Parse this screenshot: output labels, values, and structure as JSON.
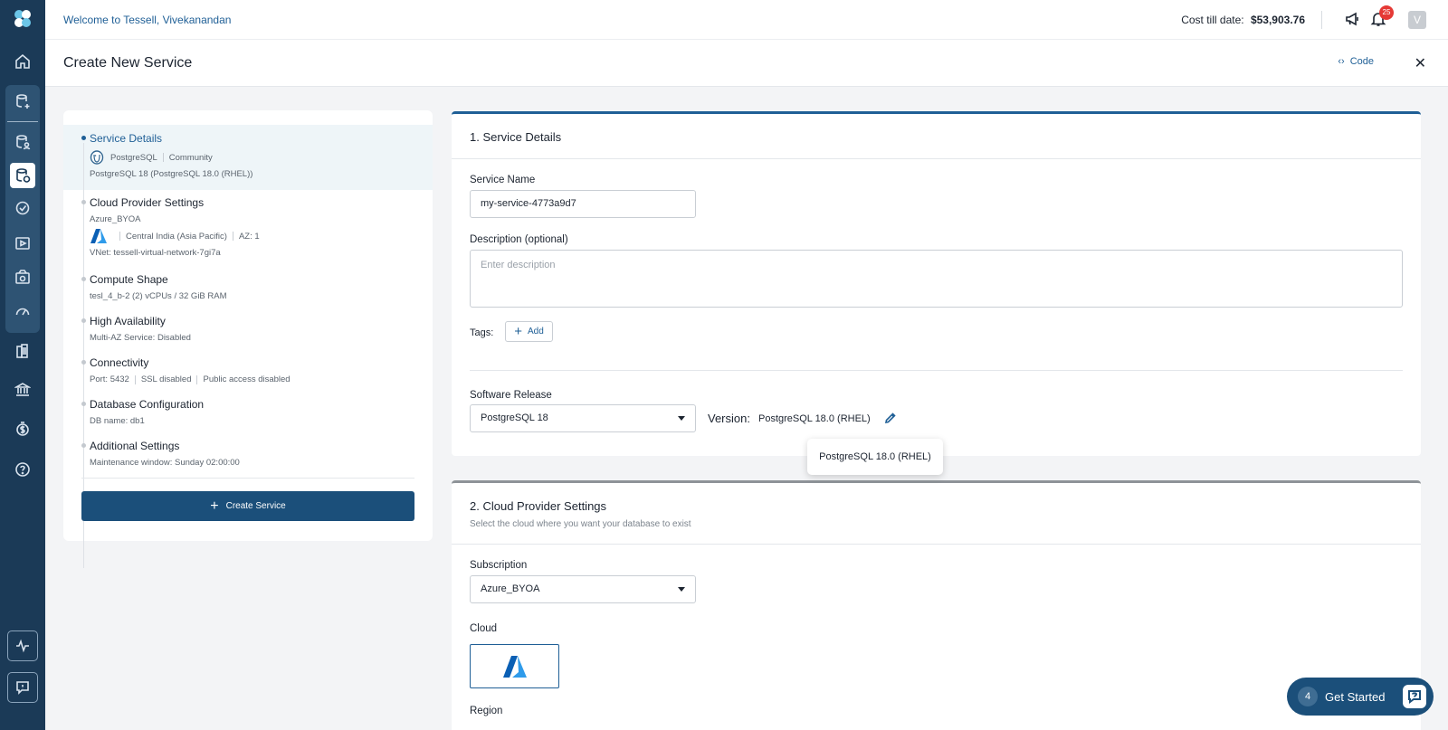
{
  "topbar": {
    "welcome": "Welcome to Tessell, Vivekanandan",
    "cost_label": "Cost till date:",
    "cost_value": "$53,903.76",
    "notification_count": "25",
    "avatar_initial": "V"
  },
  "header": {
    "title": "Create New Service",
    "code_label": "Code",
    "close_glyph": "✕"
  },
  "summary": {
    "items": [
      {
        "title": "Service Details",
        "line1_a": "PostgreSQL",
        "line1_b": "Community",
        "line2": "PostgreSQL 18 (PostgreSQL 18.0 (RHEL))"
      },
      {
        "title": "Cloud Provider Settings",
        "line1": "Azure_BYOA",
        "line2_a": "Central India (Asia Pacific)",
        "line2_b": "AZ: 1",
        "line3": "VNet: tessell-virtual-network-7gi7a"
      },
      {
        "title": "Compute Shape",
        "line1": "tesl_4_b-2 (2) vCPUs / 32 GiB RAM"
      },
      {
        "title": "High Availability",
        "line1": "Multi-AZ Service: Disabled"
      },
      {
        "title": "Connectivity",
        "line1_a": "Port: 5432",
        "line1_b": "SSL disabled",
        "line1_c": "Public access disabled"
      },
      {
        "title": "Database Configuration",
        "line1": "DB name: db1"
      },
      {
        "title": "Additional Settings",
        "line1": "Maintenance window: Sunday 02:00:00"
      }
    ],
    "create_button": "Create Service"
  },
  "section1": {
    "title": "1. Service Details",
    "service_name_label": "Service Name",
    "service_name_value": "my-service-4773a9d7",
    "description_label": "Description (optional)",
    "description_placeholder": "Enter description",
    "tags_label": "Tags:",
    "add_label": "Add",
    "software_release_label": "Software Release",
    "software_release_value": "PostgreSQL 18",
    "version_label": "Version:",
    "version_value": "PostgreSQL 18.0 (RHEL)",
    "tooltip": "PostgreSQL 18.0 (RHEL)"
  },
  "section2": {
    "title": "2. Cloud Provider Settings",
    "subtitle": "Select the cloud where you want your database to exist",
    "subscription_label": "Subscription",
    "subscription_value": "Azure_BYOA",
    "cloud_label": "Cloud",
    "region_label": "Region"
  },
  "get_started": {
    "count": "4",
    "label": "Get Started"
  },
  "colors": {
    "sidebar": "#1b3a57",
    "accent": "#1f5f96",
    "button": "#1b4f7a",
    "badge": "#e53935"
  }
}
